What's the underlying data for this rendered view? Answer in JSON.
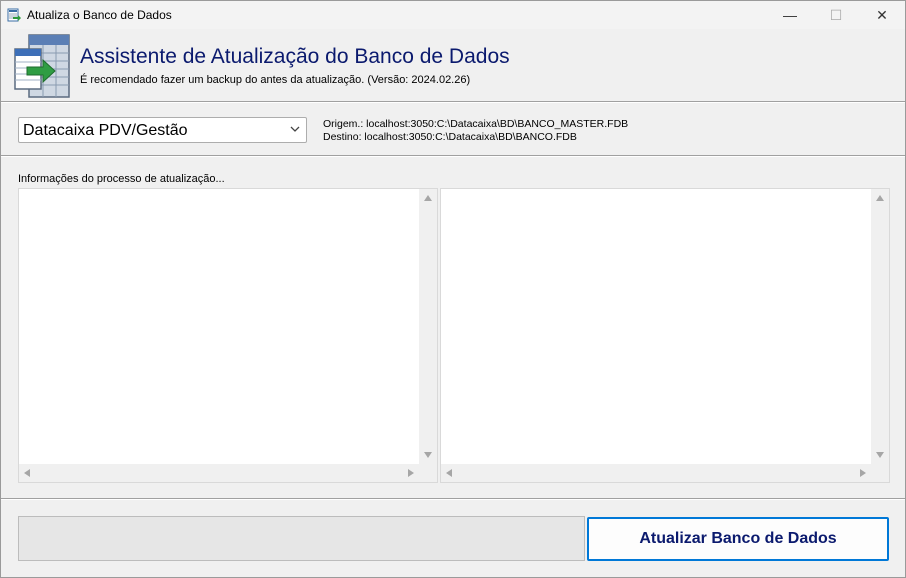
{
  "window": {
    "title": "Atualiza o Banco de Dados",
    "controls": {
      "minimize": "—",
      "maximize": "☐",
      "close": "✕"
    }
  },
  "header": {
    "icon": "database-update-icon",
    "title": "Assistente de Atualização do Banco de Dados",
    "subtitle": "É recomendado fazer um backup do antes da atualização. (Versão: 2024.02.26)"
  },
  "config": {
    "system_select": {
      "selected": "Datacaixa PDV/Gestão"
    },
    "origin": "Origem.: localhost:3050:C:\\Datacaixa\\BD\\BANCO_MASTER.FDB",
    "destination": "Destino: localhost:3050:C:\\Datacaixa\\BD\\BANCO.FDB"
  },
  "process": {
    "label": "Informações do processo de atualização..."
  },
  "footer": {
    "progress": 0,
    "update_button": "Atualizar Banco de Dados"
  },
  "colors": {
    "title_blue": "#0b1a6e",
    "focus_blue": "#0078d7",
    "window_bg": "#f0f0f0"
  }
}
